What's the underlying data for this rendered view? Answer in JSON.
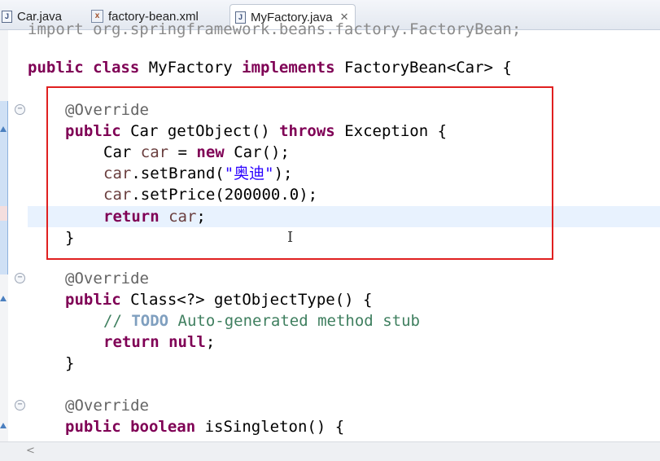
{
  "tabs": [
    {
      "label": "Car.java",
      "icon": "java-file-icon",
      "active": false
    },
    {
      "label": "factory-bean.xml",
      "icon": "xml-file-icon",
      "active": false
    },
    {
      "label": "MyFactory.java",
      "icon": "java-file-icon",
      "active": true,
      "close": "✕"
    }
  ],
  "code": {
    "cut_top": "import org.springframework.beans.factory.FactoryBean;",
    "class_decl": {
      "kw1": "public",
      "kw2": "class",
      "name": " MyFactory ",
      "kw3": "implements",
      "rest": " FactoryBean<Car> {"
    },
    "m1": {
      "ann": "@Override",
      "sig": {
        "kw": "public",
        "rest1": " Car getObject() ",
        "kw2": "throws",
        "rest2": " Exception {"
      },
      "l1": {
        "a": "Car ",
        "fld": "car",
        "b": " = ",
        "kw": "new",
        "c": " Car();"
      },
      "l2": {
        "fld": "car",
        "a": ".setBrand(",
        "str": "\"奥迪\"",
        "b": ");"
      },
      "l3": {
        "fld": "car",
        "a": ".setPrice(200000.0);"
      },
      "l4": {
        "kw": "return",
        "fld": " car",
        "a": ";"
      },
      "close": "}"
    },
    "m2": {
      "ann": "@Override",
      "sig": {
        "kw": "public",
        "rest": " Class<?> getObjectType() {"
      },
      "comment": {
        "a": "// ",
        "todo": "TODO",
        "b": " Auto-generated method stub"
      },
      "ret": {
        "kw": "return",
        "kw2": " null",
        "a": ";"
      },
      "close": "}"
    },
    "m3": {
      "ann": "@Override",
      "sig": {
        "kw": "public",
        "kw2": " boolean",
        "rest": " isSingleton() {"
      }
    }
  },
  "colors": {
    "keyword": "#7f0055",
    "string": "#2a00ff",
    "comment": "#3f7f5f",
    "highlight_box": "#e02020"
  }
}
